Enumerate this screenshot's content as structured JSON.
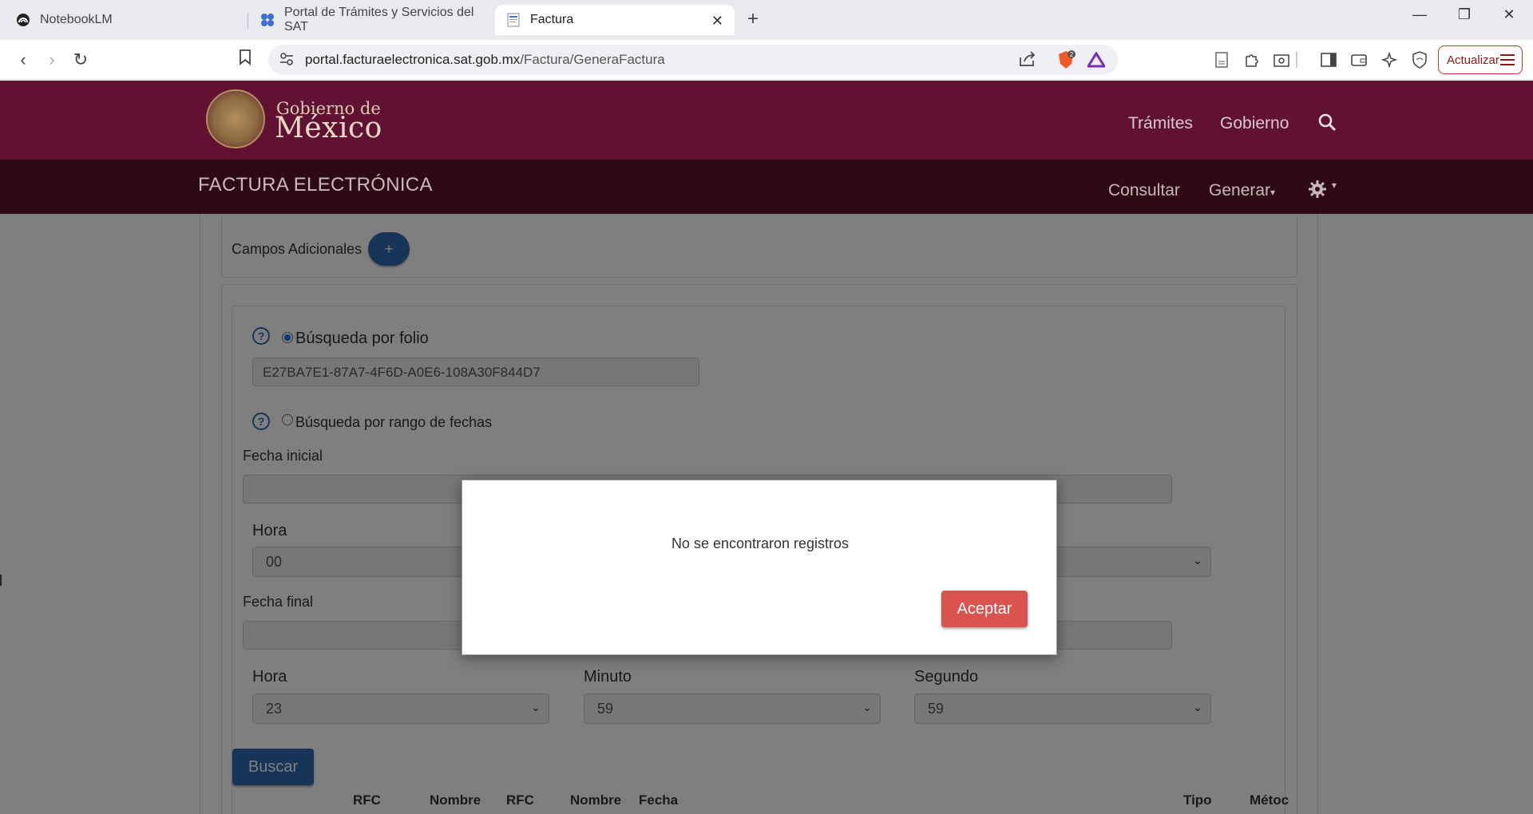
{
  "browser": {
    "tabs": [
      {
        "label": "NotebookLM",
        "icon": "notebooklm-icon"
      },
      {
        "label": "Portal de Trámites y Servicios del SAT",
        "icon": "sat-portal-icon"
      },
      {
        "label": "Factura",
        "icon": "document-icon"
      }
    ],
    "url_host": "portal.facturaelectronica.sat.gob.mx",
    "url_path": "/Factura/GeneraFactura",
    "shield_badge": "2",
    "update_label": "Actualizar"
  },
  "gov_header": {
    "logo_small": "Gobierno de",
    "logo_big": "México",
    "nav": [
      "Trámites",
      "Gobierno"
    ]
  },
  "app_header": {
    "title": "FACTURA ELECTRÓNICA",
    "nav": [
      "Consultar",
      "Generar"
    ]
  },
  "form": {
    "additional_fields_label": "Campos Adicionales",
    "add_button": "+",
    "search_by_folio_label": "Búsqueda por folio",
    "folio_value": "E27BA7E1-87A7-4F6D-A0E6-108A30F844D7",
    "search_by_dates_label": "Búsqueda por rango de fechas",
    "start_date_label": "Fecha inicial",
    "end_date_label": "Fecha final",
    "hour_label": "Hora",
    "minute_label": "Minuto",
    "second_label": "Segundo",
    "start_hour": "00",
    "end_hour": "23",
    "end_minute": "59",
    "end_second": "59",
    "search_button": "Buscar"
  },
  "table": {
    "headers": [
      "RFC",
      "Nombre",
      "RFC",
      "Nombre",
      "Fecha",
      "Tipo",
      "Métoc"
    ]
  },
  "modal": {
    "message": "No se encontraron registros",
    "accept_button": "Aceptar"
  }
}
